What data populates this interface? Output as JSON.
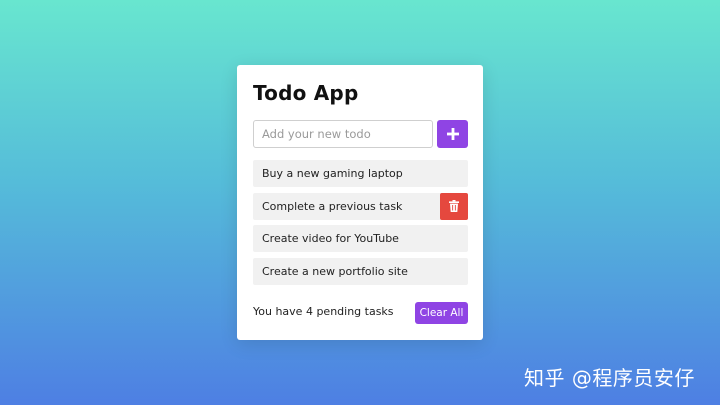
{
  "app": {
    "title": "Todo App"
  },
  "input": {
    "placeholder": "Add your new todo",
    "value": ""
  },
  "add_button": {
    "icon": "plus-icon"
  },
  "todos": [
    {
      "label": "Buy a new gaming laptop"
    },
    {
      "label": "Complete a previous task",
      "show_delete": true
    },
    {
      "label": "Create video for YouTube"
    },
    {
      "label": "Create a new portfolio site"
    }
  ],
  "footer": {
    "pending_text": "You have 4 pending tasks",
    "clear_label": "Clear All"
  },
  "watermark": {
    "text": "知乎 @程序员安仔"
  },
  "colors": {
    "accent": "#8f44e4",
    "danger": "#e5483e",
    "item_bg": "#f1f1f1"
  }
}
